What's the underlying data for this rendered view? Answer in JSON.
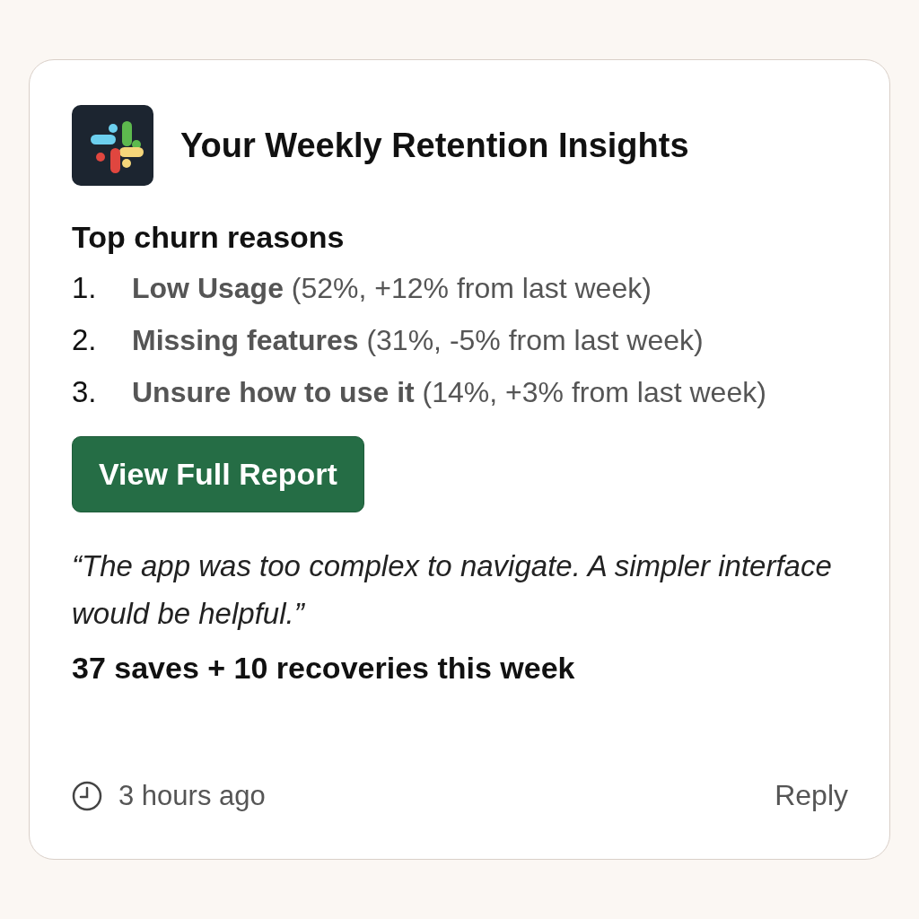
{
  "card": {
    "title": "Your Weekly Retention Insights",
    "section_heading": "Top churn reasons",
    "reasons": [
      {
        "number": "1.",
        "text": "**Low Usage** (52%, +12% from last week)"
      },
      {
        "number": "2.",
        "text": "**Missing features** (31%, -5% from last week)"
      },
      {
        "number": "3.",
        "text": "**Unsure how to use it** (14%, +3% from last week)"
      }
    ],
    "button": "View Full Report",
    "quote": "“The app was too complex to navigate. A simpler interface would be helpful.”",
    "summary": "37 saves + 10 recoveries this week",
    "footer": {
      "time": "3 hours ago",
      "reply": "Reply"
    }
  }
}
